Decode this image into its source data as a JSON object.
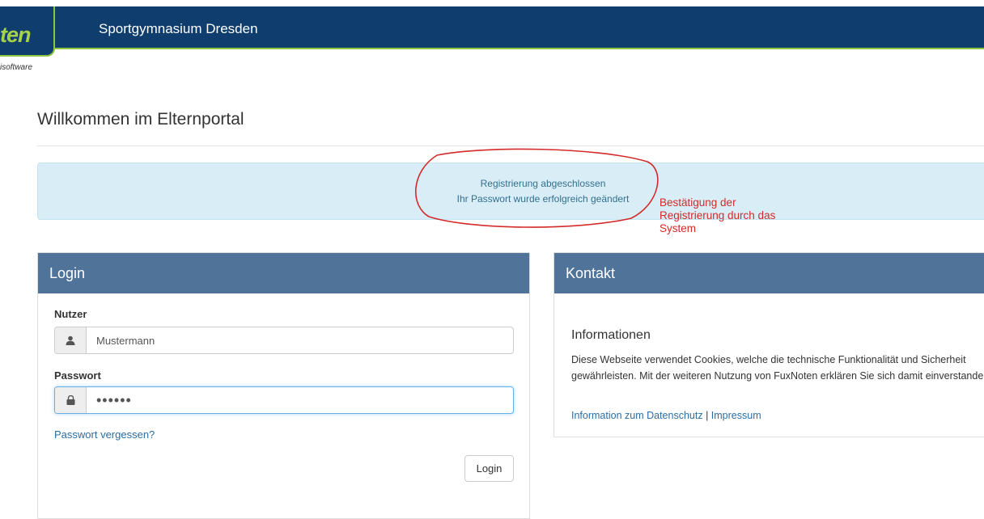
{
  "header": {
    "logo_text": "ten",
    "logo_sub": "isoftware",
    "school": "Sportgymnasium Dresden",
    "bar_color": "#0f3d6e",
    "accent_color": "#8cc63f"
  },
  "page": {
    "title": "Willkommen im Elternportal"
  },
  "alert": {
    "line1": "Registrierung abgeschlossen",
    "line2": "Ihr Passwort wurde erfolgreich geändert"
  },
  "annotation": {
    "note": "Bestätigung der Registrierung durch das System",
    "color": "#d42a2a"
  },
  "login": {
    "title": "Login",
    "user_label": "Nutzer",
    "user_value": "Mustermann",
    "user_icon": "user-icon",
    "password_label": "Passwort",
    "password_value": "••••••",
    "password_icon": "lock-icon",
    "forgot_link": "Passwort vergessen?",
    "submit": "Login"
  },
  "kontakt": {
    "title": "Kontakt",
    "info_title": "Informationen",
    "info_text": "Diese Webseite verwendet Cookies, welche die technische Funktionalität und Sicherheit gewährleisten. Mit der weiteren Nutzung von FuxNoten erklären Sie sich damit einverstanden.",
    "privacy_link": "Information zum Datenschutz",
    "separator": "|",
    "imprint_link": "Impressum"
  }
}
